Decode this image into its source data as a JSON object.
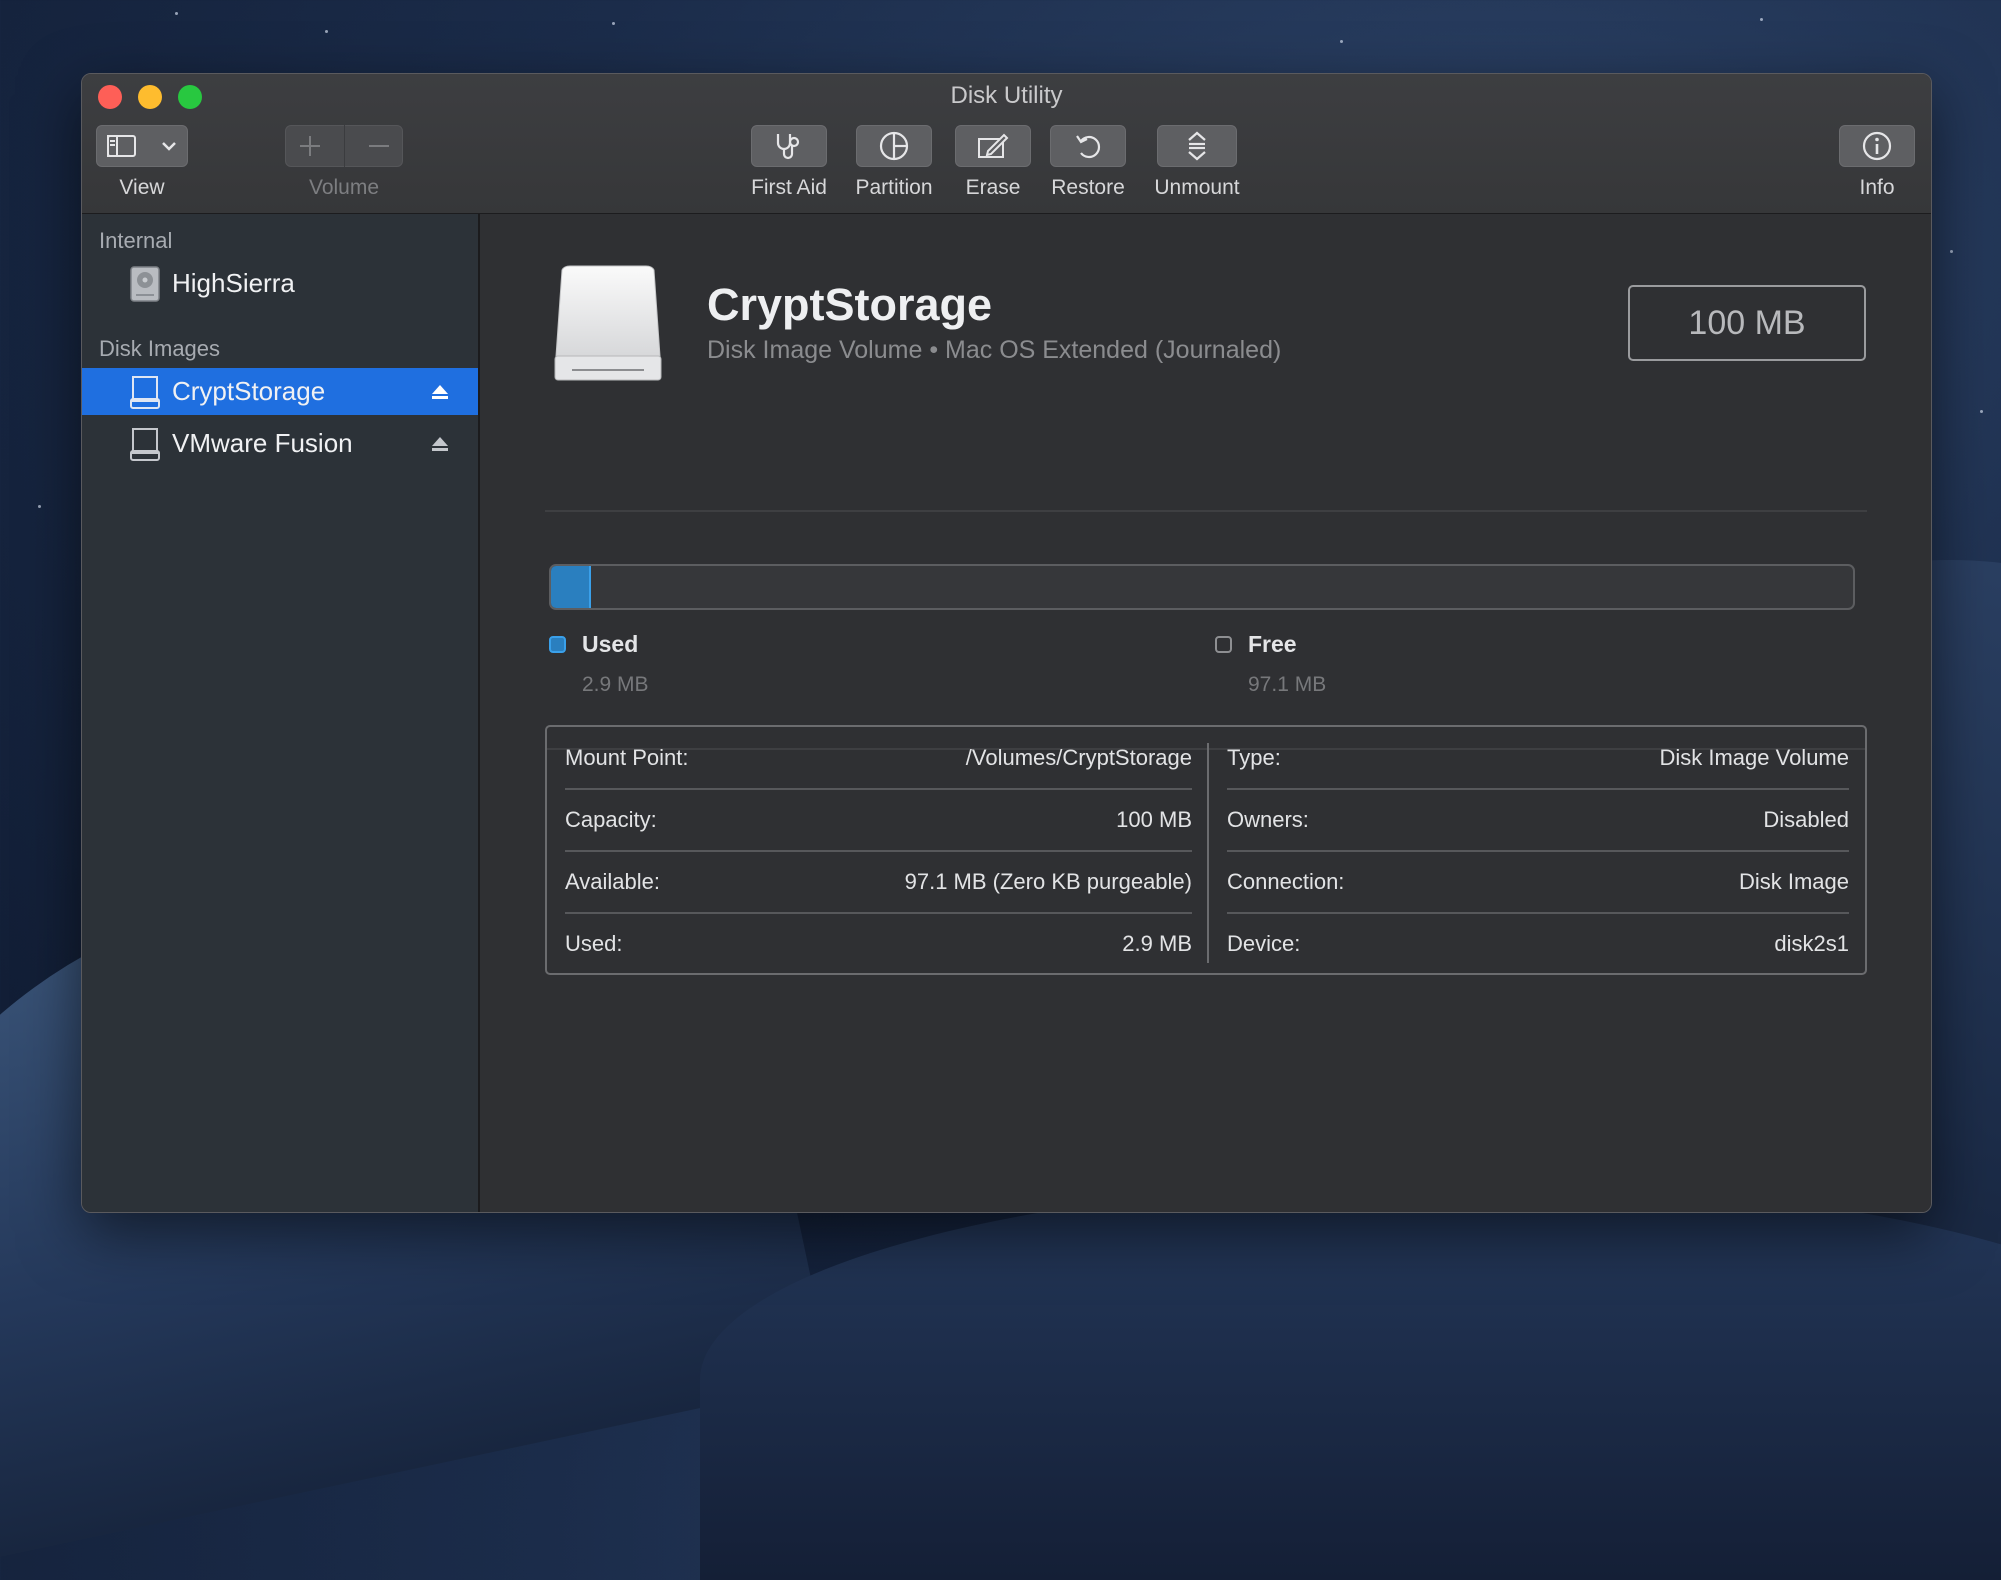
{
  "window": {
    "title": "Disk Utility"
  },
  "toolbar": {
    "view_label": "View",
    "volume_label": "Volume",
    "first_aid_label": "First Aid",
    "partition_label": "Partition",
    "erase_label": "Erase",
    "restore_label": "Restore",
    "unmount_label": "Unmount",
    "info_label": "Info"
  },
  "sidebar": {
    "sections": [
      {
        "title": "Internal",
        "items": [
          {
            "label": "HighSierra",
            "icon": "internal-disk-icon"
          }
        ]
      },
      {
        "title": "Disk Images",
        "items": [
          {
            "label": "CryptStorage",
            "icon": "disk-image-icon",
            "selected": true,
            "ejectable": true
          },
          {
            "label": "VMware Fusion",
            "icon": "disk-image-icon",
            "selected": false,
            "ejectable": true
          }
        ]
      }
    ]
  },
  "volume": {
    "name": "CryptStorage",
    "subtitle": "Disk Image Volume • Mac OS Extended (Journaled)",
    "capacity": "100 MB",
    "icon": "external-drive-icon"
  },
  "usage": {
    "used_fraction": 0.029,
    "used_label": "Used",
    "used_value": "2.9 MB",
    "free_label": "Free",
    "free_value": "97.1 MB",
    "colors": {
      "used": "#2a7fbf",
      "free": "#36373a"
    }
  },
  "info": {
    "left": [
      {
        "key": "Mount Point:",
        "value": "/Volumes/CryptStorage"
      },
      {
        "key": "Capacity:",
        "value": "100 MB"
      },
      {
        "key": "Available:",
        "value": "97.1 MB (Zero KB purgeable)"
      },
      {
        "key": "Used:",
        "value": "2.9 MB"
      }
    ],
    "right": [
      {
        "key": "Type:",
        "value": "Disk Image Volume"
      },
      {
        "key": "Owners:",
        "value": "Disabled"
      },
      {
        "key": "Connection:",
        "value": "Disk Image"
      },
      {
        "key": "Device:",
        "value": "disk2s1"
      }
    ]
  },
  "colors": {
    "accent": "#1f6fe0",
    "sidebar_bg": "#2c3238",
    "main_bg": "#2f3033"
  }
}
